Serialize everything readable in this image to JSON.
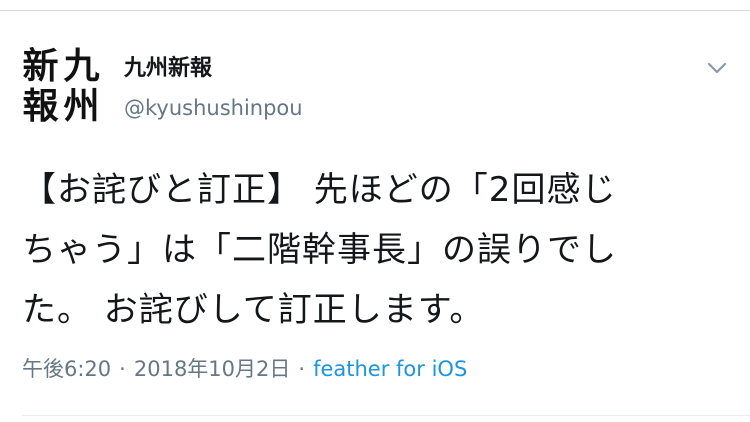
{
  "user": {
    "avatar_chars": [
      "新",
      "九",
      "報",
      "州"
    ],
    "display_name": "九州新報",
    "handle": "@kyushushinpou"
  },
  "tweet": {
    "lines": [
      "【お詫びと訂正】 先ほどの「2回感じ",
      "ちゃう」は「二階幹事長」の誤りでし",
      "た。 お詫びして訂正します。"
    ]
  },
  "meta": {
    "time": "午後6:20",
    "separator": "·",
    "date": "2018年10月2日",
    "source": "feather for iOS"
  },
  "icons": {
    "menu": "chevron-down-icon"
  },
  "colors": {
    "text": "#14171a",
    "secondary": "#657786",
    "link": "#1b95e0",
    "divider": "#e6ecf0"
  }
}
